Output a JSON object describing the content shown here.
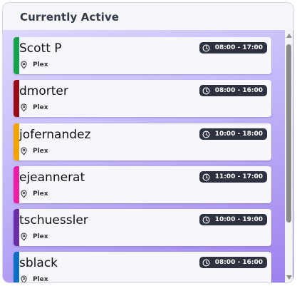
{
  "panel": {
    "title": "Currently Active"
  },
  "users": [
    {
      "name": "Scott P",
      "location": "Plex",
      "time": "08:00 - 17:00",
      "color": "#15a34a"
    },
    {
      "name": "dmorter",
      "location": "Plex",
      "time": "08:00 - 16:00",
      "color": "#9b0b16"
    },
    {
      "name": "jofernandez",
      "location": "Plex",
      "time": "10:00 - 18:00",
      "color": "#f5a300"
    },
    {
      "name": "ejeannerat",
      "location": "Plex",
      "time": "11:00 - 17:00",
      "color": "#ec1ea6"
    },
    {
      "name": "tschuessler",
      "location": "Plex",
      "time": "10:00 - 19:00",
      "color": "#6b2ca6"
    },
    {
      "name": "sblack",
      "location": "Plex",
      "time": "08:00 - 16:00",
      "color": "#0c6fc4"
    }
  ],
  "icons": {
    "location": "location-pin-icon",
    "time": "clock-icon"
  }
}
